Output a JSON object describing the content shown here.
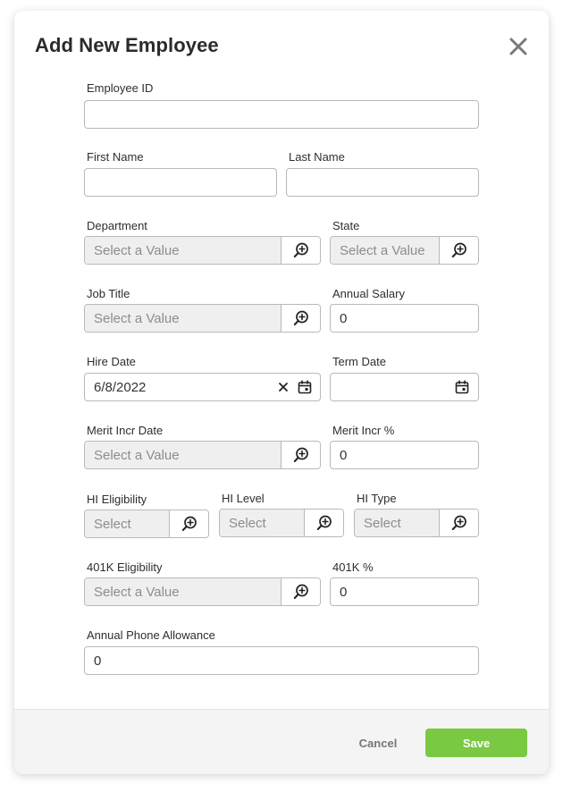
{
  "dialog": {
    "title": "Add New Employee"
  },
  "fields": {
    "employee_id": {
      "label": "Employee ID",
      "value": ""
    },
    "first_name": {
      "label": "First Name",
      "value": ""
    },
    "last_name": {
      "label": "Last Name",
      "value": ""
    },
    "department": {
      "label": "Department",
      "placeholder": "Select a Value"
    },
    "state": {
      "label": "State",
      "placeholder": "Select a Value"
    },
    "job_title": {
      "label": "Job Title",
      "placeholder": "Select a Value"
    },
    "annual_salary": {
      "label": "Annual Salary",
      "value": "0"
    },
    "hire_date": {
      "label": "Hire Date",
      "value": "6/8/2022"
    },
    "term_date": {
      "label": "Term Date",
      "value": ""
    },
    "merit_incr_date": {
      "label": "Merit Incr Date",
      "placeholder": "Select a Value"
    },
    "merit_incr_pct": {
      "label": "Merit Incr %",
      "value": "0"
    },
    "hi_eligibility": {
      "label": "HI Eligibility",
      "placeholder": "Select"
    },
    "hi_level": {
      "label": "HI Level",
      "placeholder": "Select"
    },
    "hi_type": {
      "label": "HI Type",
      "placeholder": "Select"
    },
    "k401_eligibility": {
      "label": "401K Eligibility",
      "placeholder": "Select a Value"
    },
    "k401_pct": {
      "label": "401K %",
      "value": "0"
    },
    "annual_phone_allowance": {
      "label": "Annual Phone Allowance",
      "value": "0"
    }
  },
  "footer": {
    "cancel_label": "Cancel",
    "save_label": "Save"
  },
  "icons": {
    "close": "close-icon",
    "lookup": "search-plus-icon",
    "calendar": "calendar-icon",
    "clear": "clear-icon"
  },
  "colors": {
    "save_button": "#7ac943",
    "lookup_bg": "#efefef",
    "border": "#b9b9b9"
  }
}
